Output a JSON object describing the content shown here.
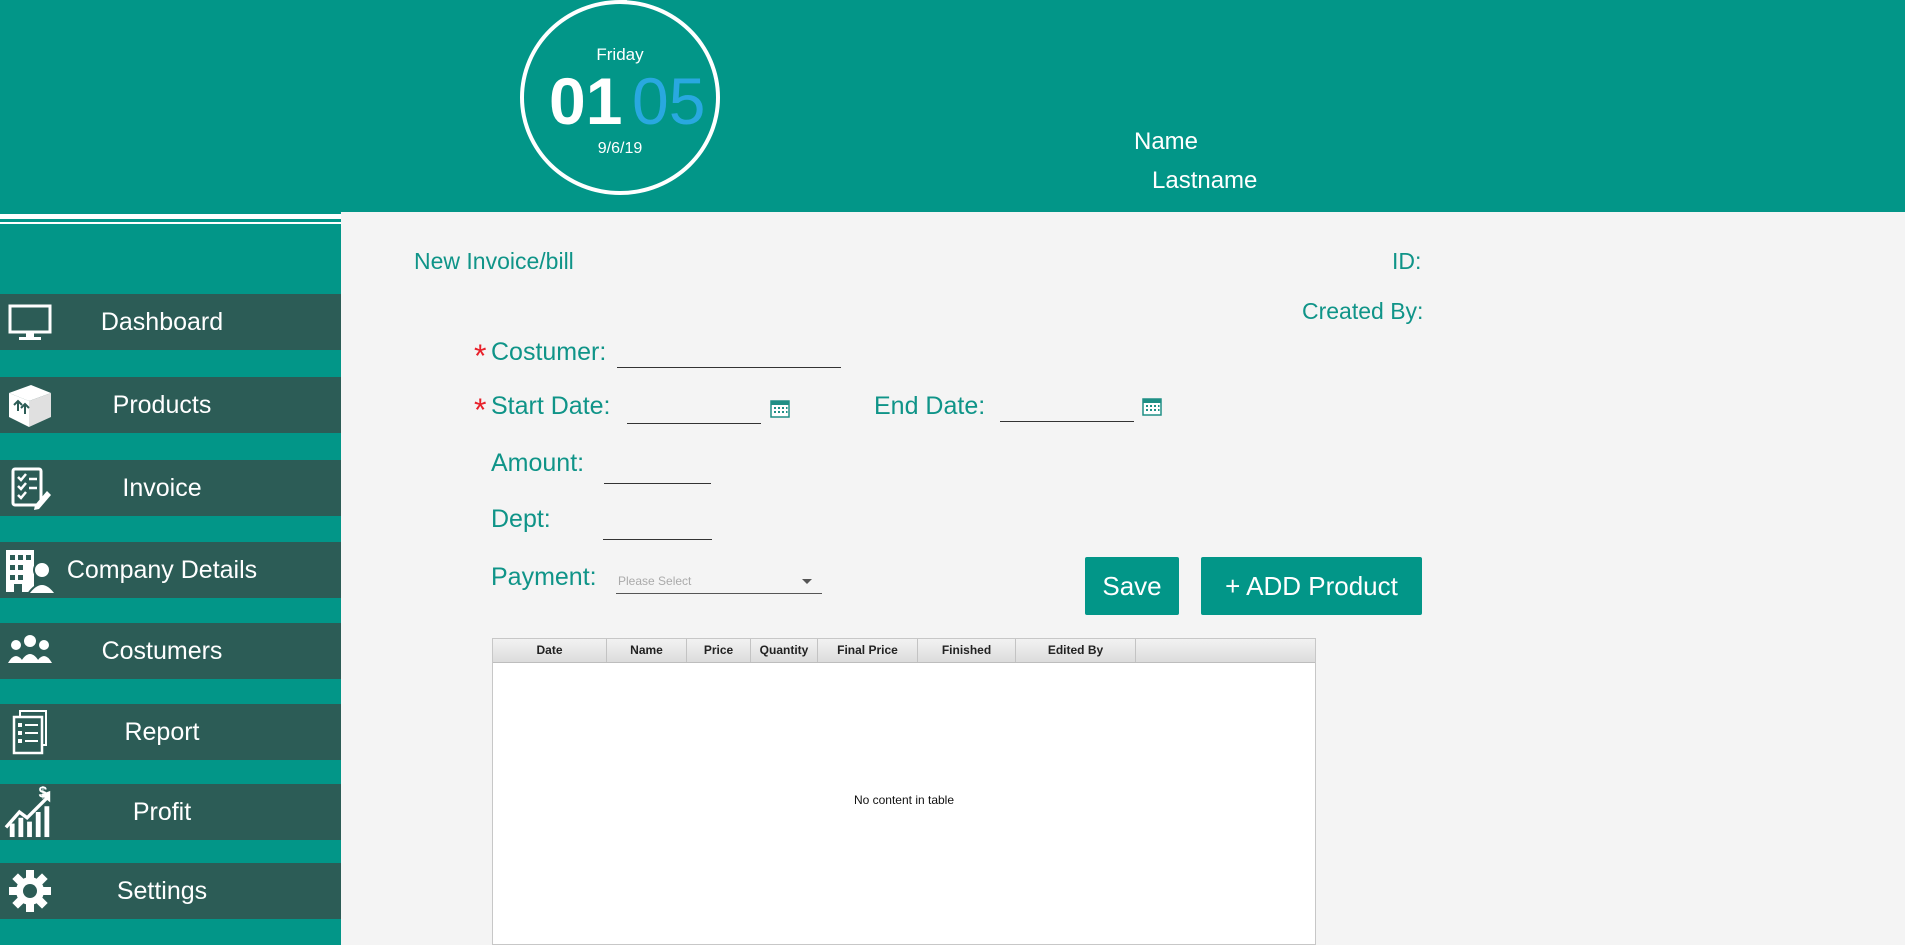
{
  "header": {
    "clock": {
      "day": "Friday",
      "hour": "01",
      "minute": "05",
      "date": "9/6/19"
    },
    "user": {
      "name": "Name",
      "lastname": "Lastname"
    }
  },
  "sidebar": {
    "items": [
      {
        "label": "Dashboard",
        "icon": "monitor-icon"
      },
      {
        "label": "Products",
        "icon": "box-icon"
      },
      {
        "label": "Invoice",
        "icon": "checklist-icon"
      },
      {
        "label": "Company Details",
        "icon": "building-icon"
      },
      {
        "label": "Costumers",
        "icon": "people-icon"
      },
      {
        "label": "Report",
        "icon": "report-icon"
      },
      {
        "label": "Profit",
        "icon": "profit-chart-icon"
      },
      {
        "label": "Settings",
        "icon": "gear-icon"
      }
    ]
  },
  "form": {
    "title": "New Invoice/bill",
    "id_label": "ID:",
    "created_by_label": "Created By:",
    "required_mark": "*",
    "customer_label": "Costumer:",
    "start_date_label": "Start Date:",
    "end_date_label": "End Date:",
    "amount_label": "Amount:",
    "dept_label": "Dept:",
    "payment_label": "Payment:",
    "payment_placeholder": "Please Select",
    "save_label": "Save",
    "add_product_label": "+ ADD Product"
  },
  "table": {
    "columns": [
      "Date",
      "Name",
      "Price",
      "Quantity",
      "Final Price",
      "Finished",
      "Edited By"
    ],
    "empty_message": "No content in table"
  },
  "colors": {
    "primary": "#029688",
    "nav_item": "#2c5c56",
    "minute_accent": "#29a8e0",
    "required": "#e8202a"
  }
}
